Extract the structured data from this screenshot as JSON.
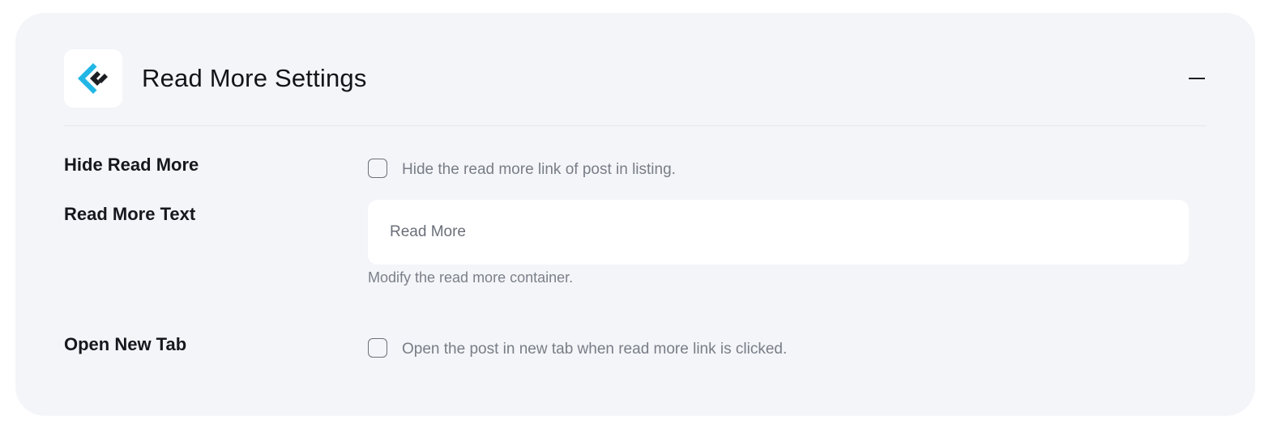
{
  "section": {
    "title": "Read More Settings",
    "logo_icon": "croco-logo-icon",
    "collapse_icon": "minus-icon"
  },
  "fields": {
    "hide_read_more": {
      "label": "Hide Read More",
      "checked": false,
      "description": "Hide the read more link of post in listing."
    },
    "read_more_text": {
      "label": "Read More Text",
      "value": "Read More",
      "help": "Modify the read more container."
    },
    "open_new_tab": {
      "label": "Open New Tab",
      "checked": false,
      "description": "Open the post in new tab when read more link is clicked."
    }
  },
  "colors": {
    "card_background": "#f4f5f9",
    "logo_accent": "#22b6e6",
    "logo_dark": "#1a1d22"
  }
}
